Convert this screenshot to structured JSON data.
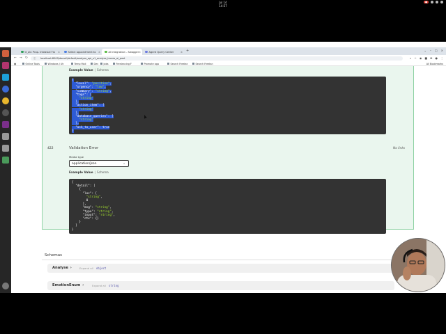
{
  "system": {
    "clock": "Jul 14  14:57",
    "recording_badge": "●"
  },
  "tabs": [
    {
      "label": "tt_ab: Prop. Inteasial Fla",
      "color": "#2f9e5b",
      "active": false
    },
    {
      "label": "Select appointment to",
      "color": "#4d7fe3",
      "active": false
    },
    {
      "label": "AI Integration - Swagger",
      "color": "#5bbc45",
      "active": true
    },
    {
      "label": "Agent Query Center",
      "color": "#6c7ae0",
      "active": false
    }
  ],
  "address": {
    "url": "localhost:8000/docs#/default/analyze_api_v1_analyze_issues_ai_post"
  },
  "bookmarks": [
    "Online Tools",
    "Windows / Uh",
    "Temp Mail",
    "Dev",
    "Jobs",
    "Freelancing F",
    "Promote app",
    "Search Freelan",
    "Search Freelan"
  ],
  "all_bookmarks": "All Bookmarks",
  "panel": {
    "example1": {
      "label": "Example Value",
      "schema": "Schema"
    },
    "code1": [
      "{",
      "  \"level\": \"positive\",",
      "  \"urgency\": \"low\",",
      "  \"summary\": \"string\",",
      "  \"tags\": [",
      "    \"string\"",
      "  ],",
      "  \"action_item\": [",
      "    \"string\"",
      "  ],",
      "  \"database_queries\": [",
      "    \"string\"",
      "  ],",
      "  \"ask_to_user\": true",
      "}"
    ],
    "status_code": "422",
    "status_desc": "Validation Error",
    "no_links": "No links",
    "media_type_label": "Media type",
    "media_type_value": "application/json",
    "example2": {
      "label": "Example Value",
      "schema": "Schema"
    },
    "code2": [
      "{",
      "  \"detail\": [",
      "    {",
      "      \"loc\": [",
      "        \"string\",",
      "        0",
      "      ],",
      "      \"msg\": \"string\",",
      "      \"type\": \"string\",",
      "      \"input\": \"string\",",
      "      \"ctx\": {}",
      "    }",
      "  ]",
      "}"
    ]
  },
  "schemas": {
    "title": "Schemas",
    "models": [
      {
        "name": "Analyse",
        "kind": "Expand all",
        "type": "object"
      },
      {
        "name": "EmotionEnum",
        "kind": "Expand all",
        "type": "string"
      }
    ]
  }
}
